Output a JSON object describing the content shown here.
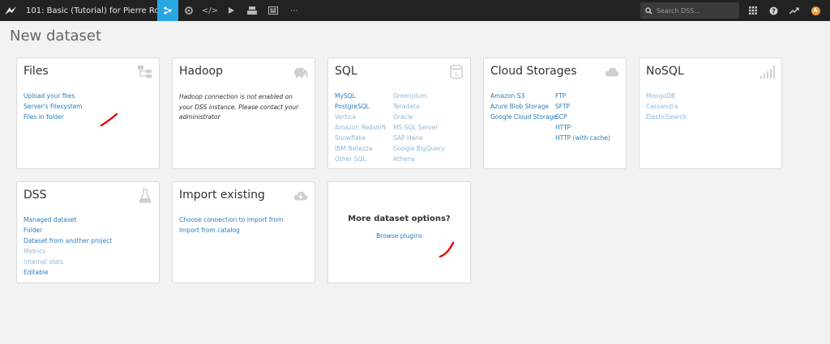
{
  "topbar": {
    "project_title": "101: Basic (Tutorial) for Pierre Ro...",
    "search_placeholder": "Search DSS...",
    "avatar_letter": "A",
    "accent_color": "#29a7e1",
    "icons": [
      "bird-logo-icon",
      "flow-icon",
      "recipes-icon",
      "code-icon",
      "run-icon",
      "dashboards-icon",
      "datasets-icon",
      "more-icon",
      "search-icon",
      "apps-grid-icon",
      "help-icon",
      "activity-icon"
    ]
  },
  "page": {
    "title": "New dataset"
  },
  "cards": {
    "files": {
      "title": "Files",
      "links": [
        "Upload your files",
        "Server's Filesystem",
        "Files in folder"
      ]
    },
    "hadoop": {
      "title": "Hadoop",
      "note": "Hadoop connection is not enabled on your DSS instance. Please contact your administrator"
    },
    "sql": {
      "title": "SQL",
      "col1": [
        "MySQL",
        "PostgreSQL",
        "Vertica",
        "Amazon Redshift",
        "Snowflake",
        "IBM Netezza",
        "Other SQL"
      ],
      "col2": [
        "Greenplum",
        "Teradata",
        "Oracle",
        "MS SQL Server",
        "SAP Hana",
        "Google BigQuery",
        "Athena"
      ]
    },
    "cloud": {
      "title": "Cloud Storages",
      "col1": [
        "Amazon S3",
        "Azure Blob Storage",
        "Google Cloud Storage"
      ],
      "col2": [
        "FTP",
        "SFTP",
        "SCP",
        "HTTP",
        "HTTP (with cache)"
      ]
    },
    "nosql": {
      "title": "NoSQL",
      "links": [
        "MongoDB",
        "Cassandra",
        "ElasticSearch"
      ]
    },
    "dss": {
      "title": "DSS",
      "links": [
        "Managed dataset",
        "Folder",
        "Dataset from another project",
        "Metrics",
        "Internal stats",
        "Editable"
      ]
    },
    "import": {
      "title": "Import existing",
      "links": [
        "Choose connection to import from",
        "Import from catalog"
      ]
    },
    "more": {
      "title": "More dataset options?",
      "link": "Browse plugins"
    }
  }
}
